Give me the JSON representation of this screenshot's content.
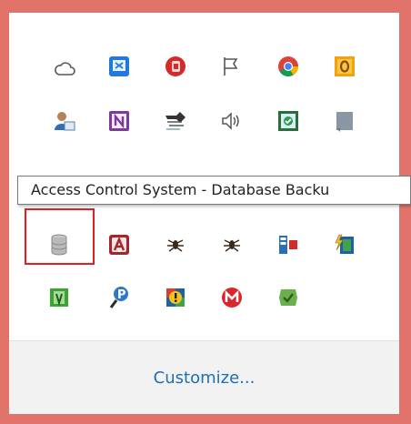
{
  "tooltip": {
    "text": "Access Control System - Database Backu"
  },
  "customize": {
    "label": "Customize..."
  },
  "icons": [
    {
      "name": "onedrive-icon"
    },
    {
      "name": "excel-icon"
    },
    {
      "name": "badge-b-icon"
    },
    {
      "name": "action-center-flag-icon"
    },
    {
      "name": "chrome-icon"
    },
    {
      "name": "outlook-icon"
    },
    {
      "name": "user-card-icon"
    },
    {
      "name": "onenote-icon"
    },
    {
      "name": "network-arrow-icon"
    },
    {
      "name": "volume-icon"
    },
    {
      "name": "remote-desktop-icon"
    },
    {
      "name": "gray-square-icon"
    },
    {
      "name": "database-backup-icon"
    },
    {
      "name": "access-a-icon"
    },
    {
      "name": "ant-icon"
    },
    {
      "name": "ant-icon-2"
    },
    {
      "name": "window-split-icon"
    },
    {
      "name": "bolt-window-icon"
    },
    {
      "name": "green-box-icon"
    },
    {
      "name": "blue-p-icon"
    },
    {
      "name": "shield-exclamation-icon"
    },
    {
      "name": "mega-icon"
    },
    {
      "name": "green-check-icon"
    }
  ],
  "colors": {
    "background": "#e2736b",
    "highlight": "#e02020",
    "link": "#1d6fb5"
  }
}
